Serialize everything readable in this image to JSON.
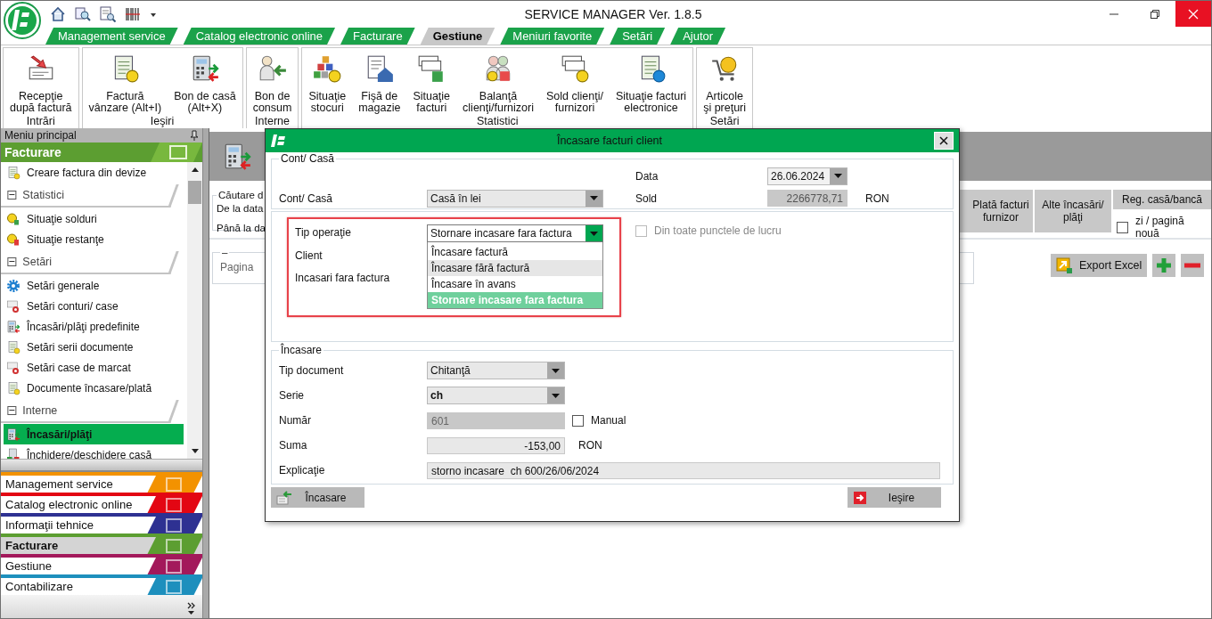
{
  "window": {
    "title": "SERVICE MANAGER Ver. 1.8.5"
  },
  "menu_tabs": [
    {
      "label": "Management service",
      "selected": false
    },
    {
      "label": "Catalog electronic online",
      "selected": false
    },
    {
      "label": "Facturare",
      "selected": false
    },
    {
      "label": "Gestiune",
      "selected": true
    },
    {
      "label": "Meniuri favorite",
      "selected": false
    },
    {
      "label": "Setări",
      "selected": false
    },
    {
      "label": "Ajutor",
      "selected": false
    }
  ],
  "ribbon": [
    {
      "label": "Intrări",
      "buttons": [
        "Recepţie\ndupă factură"
      ]
    },
    {
      "label": "Ieşiri",
      "buttons": [
        "Factură\nvânzare (Alt+I)",
        "Bon de casă\n(Alt+X)"
      ]
    },
    {
      "label": "Interne",
      "buttons": [
        "Bon de\nconsum"
      ]
    },
    {
      "label": "Statistici",
      "buttons": [
        "Situaţie\nstocuri",
        "Fişă de\nmagazie",
        "Situaţie\nfacturi",
        "Balanţă\nclienţi/furnizori",
        "Sold clienţi/\nfurnizori",
        "Situaţie facturi\nelectronice"
      ]
    },
    {
      "label": "Setări",
      "buttons": [
        "Articole\nşi preţuri"
      ]
    }
  ],
  "sidebar": {
    "title": "Meniu principal",
    "section": "Facturare",
    "items": [
      {
        "kind": "item",
        "label": "Creare factura din devize",
        "selected": false
      },
      {
        "kind": "group",
        "label": "Statistici",
        "expanded": true,
        "children": [
          {
            "label": "Situaţie solduri",
            "selected": false
          },
          {
            "label": "Situaţie restanţe",
            "selected": false
          }
        ]
      },
      {
        "kind": "group",
        "label": "Setări",
        "expanded": true,
        "children": [
          {
            "label": "Setări generale",
            "selected": false
          },
          {
            "label": "Setări conturi/ case",
            "selected": false
          },
          {
            "label": "Încasări/plăţi predefinite",
            "selected": false
          },
          {
            "label": "Setări serii documente",
            "selected": false
          },
          {
            "label": "Setări case de marcat",
            "selected": false
          },
          {
            "label": "Documente încasare/plată",
            "selected": false
          }
        ]
      },
      {
        "kind": "group",
        "label": "Interne",
        "expanded": true,
        "children": [
          {
            "label": "Încasări/plăţi",
            "selected": true
          },
          {
            "label": "Închidere/deschidere casă",
            "selected": false
          }
        ]
      }
    ],
    "nav_sections": [
      {
        "label": "Management service",
        "color": "#f39200",
        "selected": false
      },
      {
        "label": "Catalog electronic online",
        "color": "#e30613",
        "selected": false
      },
      {
        "label": "Informaţii tehnice",
        "color": "#2e3192",
        "selected": false
      },
      {
        "label": "Facturare",
        "color": "#5c9e31",
        "selected": true
      },
      {
        "label": "Gestiune",
        "color": "#a3195b",
        "selected": false
      },
      {
        "label": "Contabilizare",
        "color": "#1d8fbd",
        "selected": false
      }
    ]
  },
  "background_form": {
    "search_legend": "Căutare d",
    "from_label": "De la data",
    "to_label": "Până la da",
    "actions": [
      "Plată facturi\nfurnizor",
      "Alte încasări/\nplăţi"
    ],
    "register": {
      "title": "Reg. casă/bancă",
      "new_page": {
        "label": "zi / pagină nouă",
        "checked": false
      }
    },
    "page_legend": "–",
    "page_label": "Pagina",
    "export_button": "Export Excel"
  },
  "dialog": {
    "title": "Încasare facturi client",
    "account_group": {
      "legend": "Cont/ Casă",
      "date_label": "Data",
      "date_value": "26.06.2024",
      "account_label": "Cont/ Casă",
      "account_value": "Casă în lei",
      "balance_label": "Sold",
      "balance_value": "2266778,71",
      "balance_currency": "RON"
    },
    "operation_group": {
      "highlighted": true,
      "operation_label": "Tip operaţie",
      "operation_value": "Stornare incasare fara factura",
      "expanded": true,
      "options": [
        {
          "label": "Încasare factură",
          "selected": false,
          "hovered": false
        },
        {
          "label": "Încasare fără factură",
          "selected": false,
          "hovered": true
        },
        {
          "label": "Încasare în avans",
          "selected": false,
          "hovered": false
        },
        {
          "label": "Stornare incasare fara factura",
          "selected": true,
          "hovered": false
        }
      ],
      "client_label": "Client",
      "mode_label": "Incasari fara factura",
      "all_points": {
        "label": "Din toate punctele de lucru",
        "checked": false,
        "disabled": true
      }
    },
    "payment_group": {
      "legend": "Încasare",
      "fields": [
        {
          "kind": "combo",
          "label": "Tip document",
          "value": "Chitanţă",
          "emphasized": false
        },
        {
          "kind": "combo",
          "label": "Serie",
          "value": "ch",
          "emphasized": true
        },
        {
          "kind": "text",
          "label": "Număr",
          "value": "601",
          "disabled": true,
          "checkbox": {
            "label": "Manual",
            "checked": false
          }
        },
        {
          "kind": "text",
          "label": "Suma",
          "value": "-153,00",
          "numeric": true,
          "unit": "RON"
        },
        {
          "kind": "text",
          "label": "Explicaţie",
          "value": "storno incasare  ch 600/26/06/2024",
          "wide": true
        }
      ]
    },
    "buttons": [
      {
        "kind": "confirm",
        "label": "Încasare"
      },
      {
        "kind": "exit",
        "label": "Ieşire"
      }
    ]
  }
}
